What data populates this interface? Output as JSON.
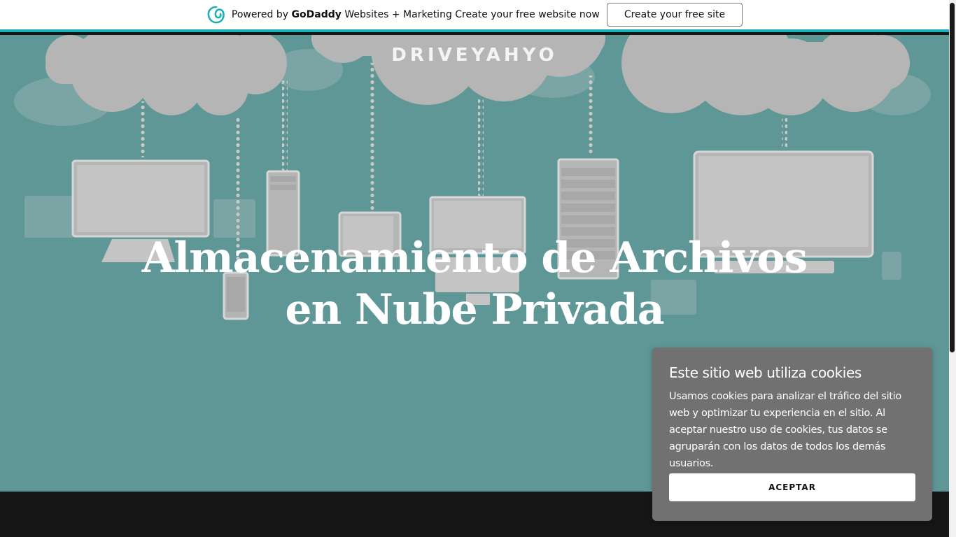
{
  "banner": {
    "powered_by": "Powered by",
    "brand": "GoDaddy",
    "tagline": "Websites + Marketing Create your free website now",
    "cta_label": "Create your free site",
    "logo_icon": "godaddy-logo-icon",
    "accent_color": "#1bb2b5"
  },
  "hero": {
    "site_title": "DRIVEYAHYO",
    "heading_line1": "Almacenamiento de Archivos",
    "heading_line2": "en Nube Privada",
    "background_color": "#5f9796"
  },
  "cookie_dialog": {
    "title": "Este sitio web utiliza cookies",
    "body": "Usamos cookies para analizar el tráfico del sitio web y optimizar tu experiencia en el sitio. Al aceptar nuestro uso de cookies, tus datos se agruparán con los datos de todos los demás usuarios.",
    "accept_label": "ACEPTAR"
  }
}
